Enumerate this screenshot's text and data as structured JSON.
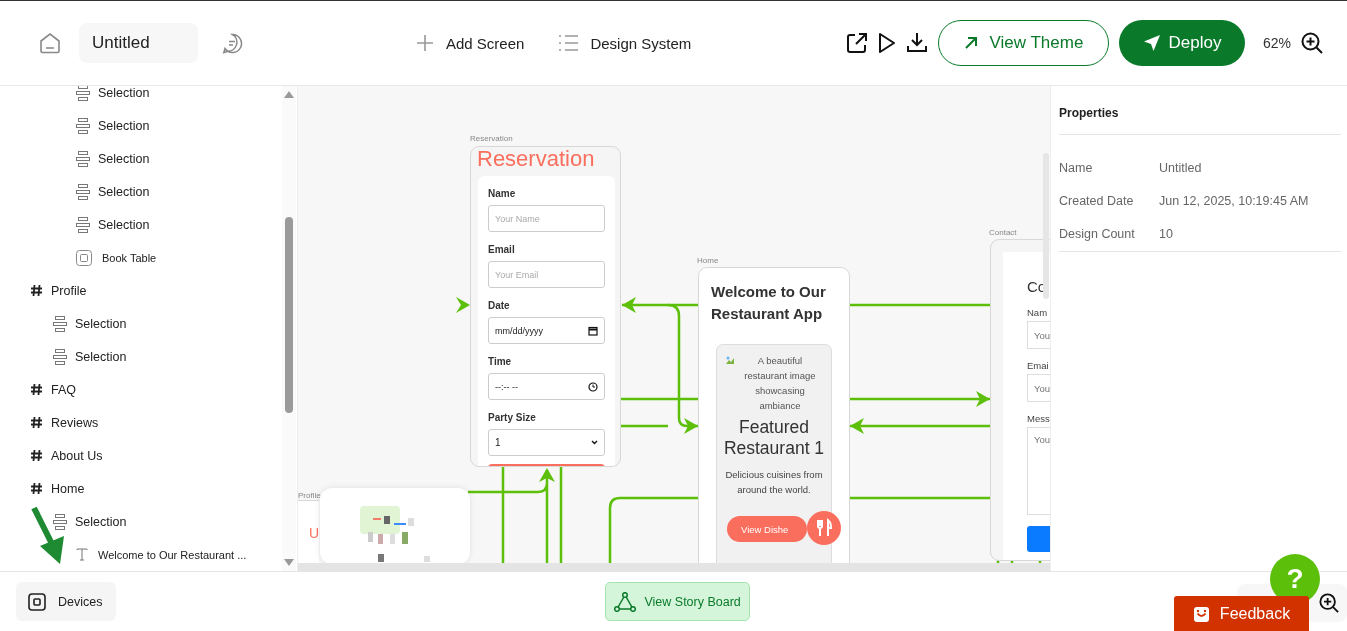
{
  "toolbar": {
    "project_title": "Untitled",
    "actions": [
      {
        "kind": "add",
        "label": "Add Screen"
      },
      {
        "kind": "list",
        "label": "Design System"
      }
    ],
    "view_theme": "View Theme",
    "deploy": "Deploy",
    "zoom": "62%"
  },
  "sidebar": {
    "scrolled_items": [
      {
        "kind": "section",
        "label": "Selection"
      },
      {
        "kind": "section",
        "label": "Selection"
      },
      {
        "kind": "section",
        "label": "Selection"
      },
      {
        "kind": "section",
        "label": "Selection"
      },
      {
        "kind": "section",
        "label": "Selection"
      },
      {
        "kind": "button",
        "label": "Book Table"
      }
    ],
    "pages": [
      {
        "kind": "page",
        "label": "Profile",
        "children": [
          {
            "kind": "section",
            "label": "Selection"
          },
          {
            "kind": "section",
            "label": "Selection"
          }
        ]
      },
      {
        "kind": "page",
        "label": "FAQ"
      },
      {
        "kind": "page",
        "label": "Reviews"
      },
      {
        "kind": "page",
        "label": "About Us"
      },
      {
        "kind": "page",
        "label": "Home",
        "children": [
          {
            "kind": "section",
            "label": "Selection",
            "children": [
              {
                "kind": "text",
                "label": "Welcome to Our Restaurant ..."
              }
            ]
          }
        ]
      }
    ]
  },
  "canvas": {
    "screens": [
      {
        "kind": "form",
        "label": "Reservation",
        "title": "Reservation",
        "fields": [
          {
            "kind": "text",
            "label": "Name",
            "placeholder": "Your Name"
          },
          {
            "kind": "text",
            "label": "Email",
            "placeholder": "Your Email"
          },
          {
            "kind": "date",
            "label": "Date",
            "value": "mm/dd/yyyy"
          },
          {
            "kind": "time",
            "label": "Time",
            "value": "--:-- --"
          },
          {
            "kind": "select",
            "label": "Party Size",
            "value": "1"
          }
        ]
      },
      {
        "kind": "home",
        "label": "Home",
        "title": "Welcome to Our Restaurant App",
        "card": {
          "image_alt": "A beautiful restaurant image showcasing ambiance",
          "heading": "Featured Restaurant 1",
          "text": "Delicious cuisines from around the world.",
          "button": "View Dishe"
        }
      },
      {
        "kind": "contact",
        "label": "Contact",
        "title": "Co",
        "fields": [
          {
            "kind": "text",
            "label": "Nam",
            "placeholder": "You"
          },
          {
            "kind": "text",
            "label": "Emai",
            "placeholder": "You"
          },
          {
            "kind": "textarea",
            "label": "Mess",
            "placeholder": "You"
          }
        ]
      },
      {
        "kind": "profile",
        "label": "Profile",
        "title": "U"
      }
    ]
  },
  "properties": {
    "title": "Properties",
    "rows": [
      {
        "label": "Name",
        "value": "Untitled"
      },
      {
        "label": "Created Date",
        "value": "Jun 12, 2025, 10:19:45 AM"
      },
      {
        "label": "Design Count",
        "value": "10"
      }
    ]
  },
  "bottom_bar": {
    "devices": "Devices",
    "story_board": "View Story Board",
    "help": "?",
    "feedback": "Feedback"
  }
}
